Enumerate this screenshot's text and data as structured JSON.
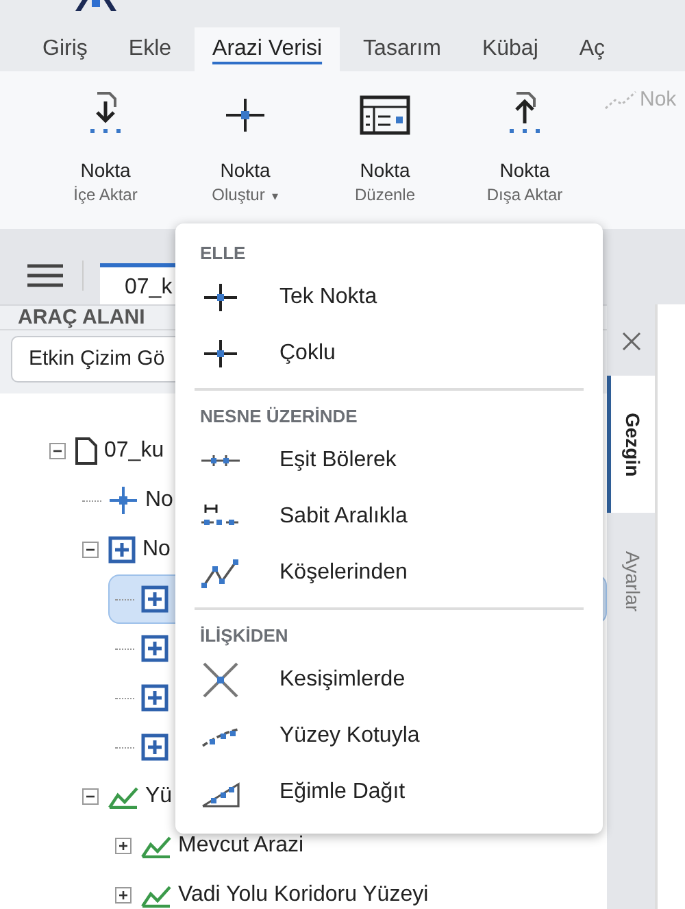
{
  "ribbon_tabs": [
    {
      "label": "Giriş",
      "selected": false
    },
    {
      "label": "Ekle",
      "selected": false
    },
    {
      "label": "Arazi Verisi",
      "selected": true
    },
    {
      "label": "Tasarım",
      "selected": false
    },
    {
      "label": "Kübaj",
      "selected": false
    },
    {
      "label": "Aç",
      "selected": false
    }
  ],
  "ribbon_buttons": [
    {
      "kind": "import",
      "label": "Nokta",
      "sublabel": "İçe Aktar"
    },
    {
      "kind": "create",
      "label": "Nokta",
      "sublabel": "Oluştur",
      "dropdown_mark": "▾"
    },
    {
      "kind": "edit",
      "label": "Nokta",
      "sublabel": "Düzenle"
    },
    {
      "kind": "export",
      "label": "Nokta",
      "sublabel": "Dışa Aktar"
    }
  ],
  "ribbon_extra": {
    "label": "Nok",
    "disabled": true
  },
  "document_tab": {
    "label": "07_k"
  },
  "panel": {
    "title": "ARAÇ ALANI",
    "dropdown_value": "Etkin Çizim Gö"
  },
  "side_tabs": [
    {
      "label": "Gezgin",
      "selected": true
    },
    {
      "label": "Ayarlar",
      "selected": false
    }
  ],
  "tree": [
    {
      "kind": "document",
      "label": "07_ku",
      "expanded": true,
      "selected": false,
      "children": [
        {
          "kind": "point",
          "label": "No",
          "selected": false
        },
        {
          "kind": "point-group",
          "label": "No",
          "expanded": true,
          "selected": false,
          "children": [
            {
              "kind": "point-group",
              "selected": true
            },
            {
              "kind": "point-group",
              "selected": false
            },
            {
              "kind": "point-group",
              "selected": false
            },
            {
              "kind": "point-group",
              "selected": false
            }
          ]
        },
        {
          "kind": "surface",
          "label": "Yü",
          "expanded": true,
          "selected": false,
          "children": [
            {
              "kind": "surface",
              "label": "Mevcut Arazi",
              "expanded": false,
              "selected": false
            },
            {
              "kind": "surface",
              "label": "Vadi Yolu Koridoru Yüzeyi",
              "expanded": false,
              "selected": false
            }
          ]
        }
      ]
    }
  ],
  "menu": {
    "sections": [
      {
        "title": "ELLE",
        "items": [
          {
            "kind": "cross",
            "label": "Tek Nokta"
          },
          {
            "kind": "cross",
            "label": "Çoklu"
          }
        ]
      },
      {
        "title": "NESNE ÜZERİNDE",
        "items": [
          {
            "kind": "divide",
            "label": "Eşit Bölerek"
          },
          {
            "kind": "interval",
            "label": "Sabit Aralıkla"
          },
          {
            "kind": "vertices",
            "label": "Köşelerinden"
          }
        ]
      },
      {
        "title": "İLİŞKİDEN",
        "items": [
          {
            "kind": "intersect",
            "label": "Kesişimlerde"
          },
          {
            "kind": "surface",
            "label": "Yüzey Kotuyla"
          },
          {
            "kind": "slope",
            "label": "Eğimle Dağıt"
          }
        ]
      }
    ]
  }
}
